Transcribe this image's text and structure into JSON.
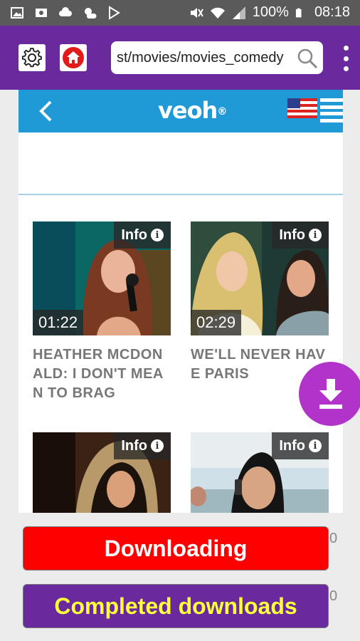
{
  "status_bar": {
    "battery_percent": "100%",
    "time": "08:18"
  },
  "toolbar": {
    "url": "st/movies/movies_comedy"
  },
  "veoh": {
    "logo_text": "veoh"
  },
  "videos": [
    {
      "info_label": "Info",
      "duration": "01:22",
      "title": "HEATHER MCDONALD: I DON'T MEAN TO BRAG"
    },
    {
      "info_label": "Info",
      "duration": "02:29",
      "title": "WE'LL NEVER HAVE PARIS"
    },
    {
      "info_label": "Info",
      "duration": "",
      "title": ""
    },
    {
      "info_label": "Info",
      "duration": "",
      "title": ""
    }
  ],
  "actions": {
    "downloading_label": "Downloading",
    "downloading_count": "0",
    "completed_label": "Completed downloads",
    "completed_count": "0"
  },
  "colors": {
    "toolbar": "#6a2a9e",
    "veoh_header": "#1f9ad6",
    "download_fab": "#b233c9",
    "downloading_button": "#ff0000",
    "completed_button": "#6a2a9e",
    "completed_text": "#ffff3a"
  }
}
